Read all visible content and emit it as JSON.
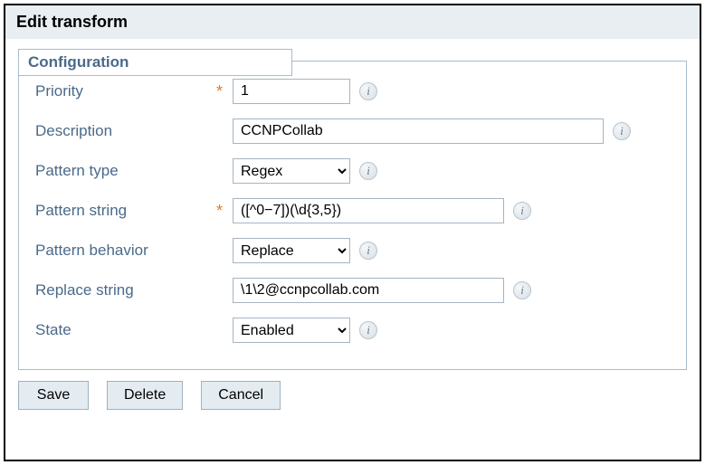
{
  "title": "Edit transform",
  "section": "Configuration",
  "fields": {
    "priority": {
      "label": "Priority",
      "value": "1",
      "required": true
    },
    "description": {
      "label": "Description",
      "value": "CCNPCollab",
      "required": false
    },
    "pattern_type": {
      "label": "Pattern type",
      "value": "Regex",
      "required": false
    },
    "pattern_string": {
      "label": "Pattern string",
      "value": "([^0−7])(\\d{3,5})",
      "required": true
    },
    "pattern_behavior": {
      "label": "Pattern behavior",
      "value": "Replace",
      "required": false
    },
    "replace_string": {
      "label": "Replace string",
      "value": "\\1\\2@ccnpcollab.com",
      "required": false
    },
    "state": {
      "label": "State",
      "value": "Enabled",
      "required": false
    }
  },
  "buttons": {
    "save": "Save",
    "delete": "Delete",
    "cancel": "Cancel"
  },
  "required_marker": "*"
}
